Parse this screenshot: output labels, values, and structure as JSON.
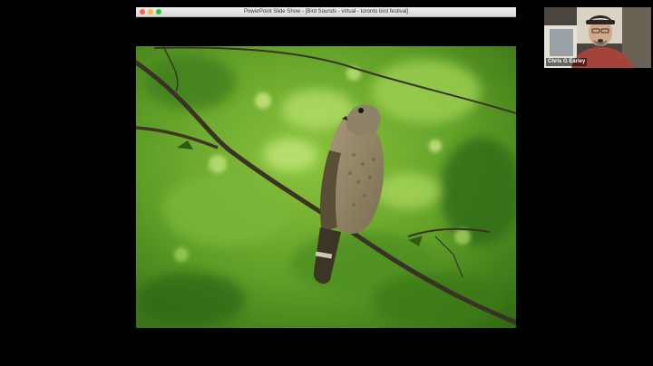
{
  "window": {
    "title": "PowerPoint Slide Show - [Bird Sounds - virtual - toronto bird festival]"
  },
  "slide": {
    "image": "perched-hawk-on-branch-photo"
  },
  "video": {
    "participant_name": "Chris G Earley"
  },
  "colors": {
    "background": "#000000",
    "foliage": "#5a9e2a",
    "titlebar": "#e4e4e4"
  }
}
